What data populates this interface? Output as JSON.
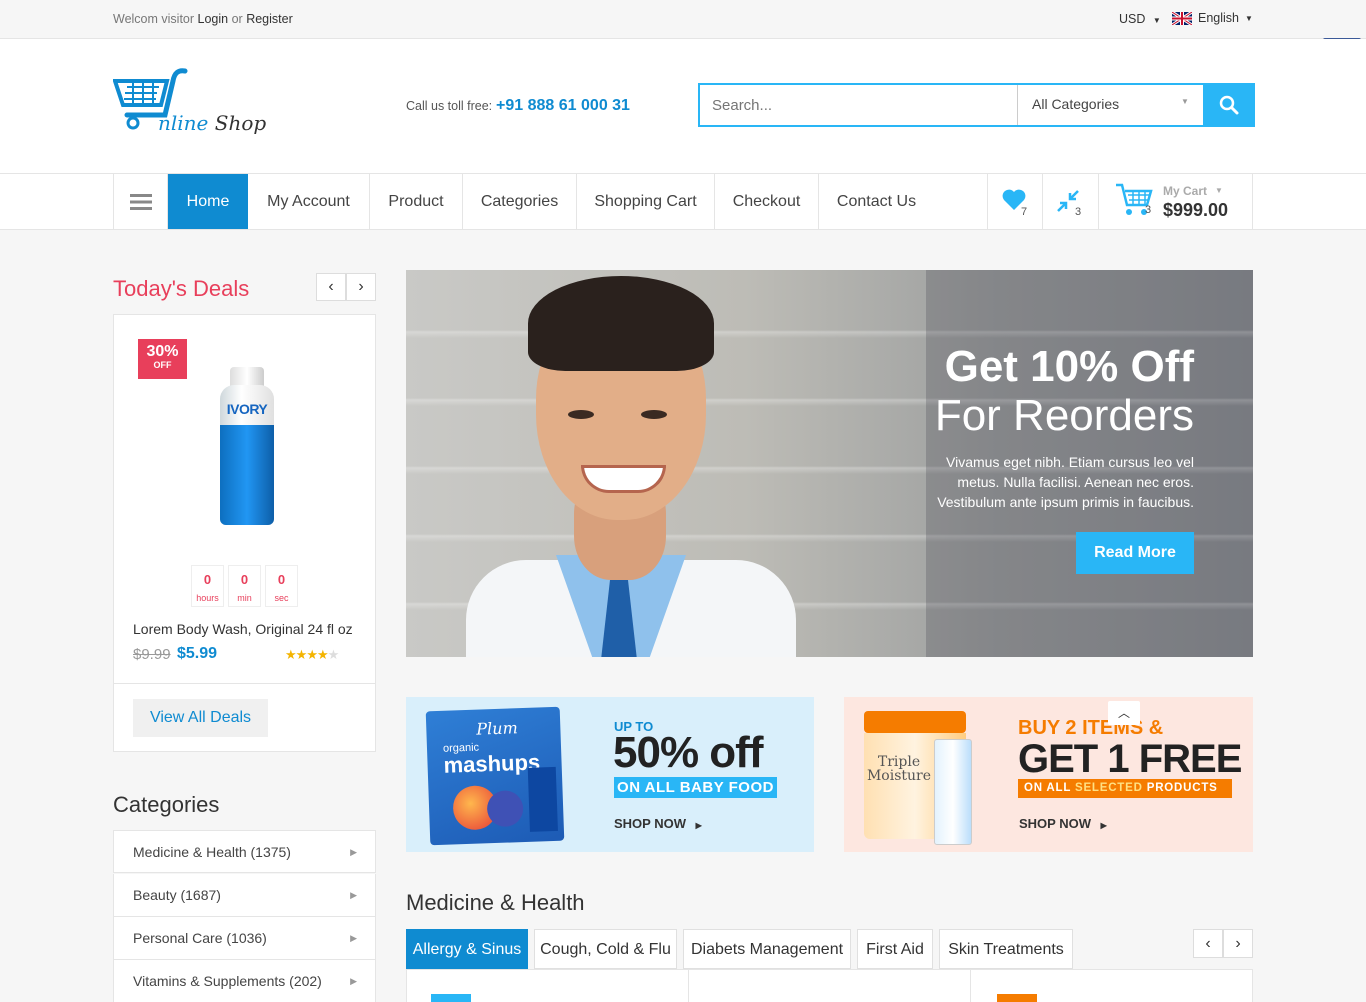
{
  "topbar": {
    "welcome": "Welcom visitor",
    "login": "Login",
    "or": "or",
    "register": "Register",
    "currency": "USD",
    "language": "English"
  },
  "header": {
    "logo_text_a": "nline",
    "logo_text_b": "Shop",
    "call_label": "Call us toll free:",
    "phone": "+91 888 61 000 31",
    "search_placeholder": "Search...",
    "category_select": "All Categories"
  },
  "nav": {
    "items": [
      "Home",
      "My Account",
      "Product",
      "Categories",
      "Shopping Cart",
      "Checkout",
      "Contact Us"
    ],
    "wishlist_count": "7",
    "compare_count": "3",
    "cart_count": "3",
    "cart_label": "My Cart",
    "cart_total": "$999.00"
  },
  "deals": {
    "title": "Today's Deals",
    "badge_pct": "30%",
    "badge_off": "OFF",
    "product_brand": "IVORY",
    "countdown": [
      {
        "value": "0",
        "unit": "hours"
      },
      {
        "value": "0",
        "unit": "min"
      },
      {
        "value": "0",
        "unit": "sec"
      }
    ],
    "product_name": "Lorem Body Wash, Original 24 fl oz",
    "old_price": "$9.99",
    "price": "$5.99",
    "rating": 4.5,
    "view_all": "View All Deals"
  },
  "hero": {
    "title": "Get 10% Off",
    "subtitle": "For Reorders",
    "body_line1": "Vivamus eget nibh. Etiam cursus leo vel",
    "body_line2": "metus. Nulla facilisi. Aenean nec eros.",
    "body_line3": "Vestibulum ante ipsum primis in faucibus.",
    "button": "Read More"
  },
  "promo1": {
    "upto": "UP TO",
    "big": "50% off",
    "band": "ON ALL BABY FOOD",
    "cta": "SHOP NOW",
    "pack_brand": "Plum",
    "pack_line1": "organic",
    "pack_line2": "mashups"
  },
  "promo2": {
    "line1": "BUY 2 ITEMS &",
    "line2": "GET 1 FREE",
    "band_a": "ON ALL",
    "band_b": "SELECTED",
    "band_c": "PRODUCTS",
    "cta": "SHOP NOW",
    "jar_label_1": "Triple",
    "jar_label_2": "Moisture"
  },
  "categories": {
    "title": "Categories",
    "items": [
      "Medicine & Health (1375)",
      "Beauty (1687)",
      "Personal Care (1036)",
      "Vitamins & Supplements (202)"
    ]
  },
  "section": {
    "title": "Medicine & Health",
    "tabs": [
      "Allergy & Sinus",
      "Cough, Cold & Flu",
      "Diabets Management",
      "First Aid",
      "Skin Treatments"
    ]
  },
  "colors": {
    "primary": "#0f8bd1",
    "accent_red": "#e83f5b",
    "button_light": "#29b6f6",
    "orange": "#f57c00"
  }
}
